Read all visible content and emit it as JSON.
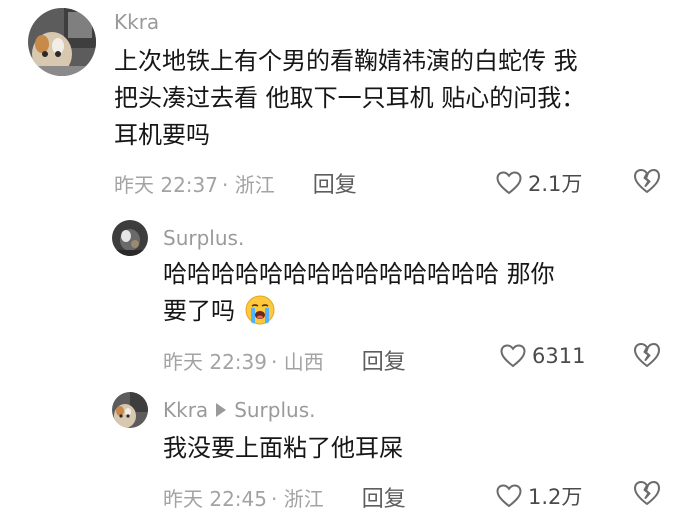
{
  "comments": [
    {
      "username": "Kkra",
      "lines": [
        "上次地铁上有个男的看鞠婧祎演的白蛇传 我",
        "把头凑过去看 他取下一只耳机 贴心的问我：",
        "耳机要吗"
      ],
      "time": "昨天 22:37",
      "location": "· 浙江",
      "reply_label": "回复",
      "likes": "2.1万"
    },
    {
      "username": "Surplus.",
      "lines": [
        "哈哈哈哈哈哈哈哈哈哈哈哈哈哈 那你",
        "要了吗"
      ],
      "time": "昨天 22:39",
      "location": "· 山西",
      "reply_label": "回复",
      "likes": "6311"
    },
    {
      "username": "Kkra",
      "reply_to": "Surplus.",
      "lines": [
        "我没要上面粘了他耳屎"
      ],
      "time": "昨天 22:45",
      "location": "· 浙江",
      "reply_label": "回复",
      "likes": "1.2万"
    }
  ],
  "icons": {
    "like": "heart-outline-icon",
    "dislike": "broken-heart-icon",
    "emoji": "loudly-crying-face-emoji"
  },
  "colors": {
    "text_primary": "#161616",
    "text_secondary": "#9a9a9a",
    "reply_button": "#5e5e5e"
  }
}
